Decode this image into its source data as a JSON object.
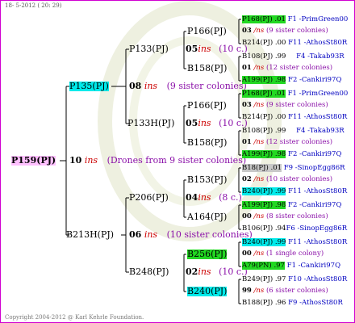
{
  "header": {
    "date": "18- 5-2012 ( 20: 29)"
  },
  "copyright": "Copyright 2004-2012 @ Karl Kehrle Foundation.",
  "root": {
    "name": "P159(PJ)",
    "gen": "10",
    "ins": "ins",
    "note": "(Drones from 9 sister colonies)"
  },
  "mother": {
    "name": "P135(PJ)",
    "gen": "08",
    "ins": "ins",
    "note": "(9 sister colonies)"
  },
  "p133": {
    "name": "P133(PJ)",
    "gen": "05",
    "ins": "ins",
    "note": "(10 c.)"
  },
  "p133h": {
    "name": "P133H(PJ)",
    "gen": "05",
    "ins": "ins",
    "note": "(10 c.)"
  },
  "b213": {
    "name": "B213H(PJ)",
    "gen": "06",
    "ins": "ins",
    "note": "(10 sister colonies)"
  },
  "p206": {
    "name": "P206(PJ)",
    "gen": "04",
    "ins": "ins",
    "note": "(8 c.)"
  },
  "b248": {
    "name": "B248(PJ)",
    "gen": "02",
    "ins": "ins",
    "note": "(10 c.)"
  },
  "p166a": "P166(PJ)",
  "b158a": "B158(PJ)",
  "p166b": "P166(PJ)",
  "b158b": "B158(PJ)",
  "b153": "B153(PJ)",
  "a164": "A164(PJ)",
  "b256": "B256(PJ)",
  "b240": "B240(PJ)",
  "r1": {
    "code": "P168(PJ) .01",
    "mark": "F1 -PrimGreen00"
  },
  "r2": {
    "gen": "03",
    "ins": "/ns",
    "note": "(9 sister colonies)"
  },
  "r3": {
    "code": "B214(PJ) .00",
    "mark": "F11 -AthosSt80R"
  },
  "r4": {
    "code": "B108(PJ) .99",
    "mark": "F4 -Takab93R"
  },
  "r5": {
    "gen": "01",
    "ins": "/ns",
    "note": "(12 sister colonies)"
  },
  "r6": {
    "code": "A199(PJ) .98",
    "mark": "F2 -Cankiri97Q"
  },
  "r7": {
    "code": "P168(PJ) .01",
    "mark": "F1 -PrimGreen00"
  },
  "r8": {
    "gen": "03",
    "ins": "/ns",
    "note": "(9 sister colonies)"
  },
  "r9": {
    "code": "B214(PJ) .00",
    "mark": "F11 -AthosSt80R"
  },
  "r10": {
    "code": "B108(PJ) .99",
    "mark": "F4 -Takab93R"
  },
  "r11": {
    "gen": "01",
    "ins": "/ns",
    "note": "(12 sister colonies)"
  },
  "r12": {
    "code": "A199(PJ) .98",
    "mark": "F2 -Cankiri97Q"
  },
  "r13": {
    "code": "B18(PJ) .01",
    "mark": "F9 -SinopEgg86R"
  },
  "r14": {
    "gen": "02",
    "ins": "/ns",
    "note": "(10 sister colonies)"
  },
  "r15": {
    "code": "B240(PJ) .99",
    "mark": "F11 -AthosSt80R"
  },
  "r16": {
    "code": "A199(PJ) .98",
    "mark": "F2 -Cankiri97Q"
  },
  "r17": {
    "gen": "00",
    "ins": "/ns",
    "note": "(8 sister colonies)"
  },
  "r18": {
    "code": "B106(PJ) .94",
    "mark": "F6 -SinopEgg86R"
  },
  "r19": {
    "code": "B240(PJ) .99",
    "mark": "F11 -AthosSt80R"
  },
  "r20": {
    "gen": "00",
    "ins": "/ns",
    "note": "(1 single colony)"
  },
  "r21": {
    "code": "A79(PN) .97",
    "mark": "F1 -Cankiri97Q"
  },
  "r22": {
    "code": "B249(PJ) .97",
    "mark": "F10 -AthosSt80R"
  },
  "r23": {
    "gen": "99",
    "ins": "/ns",
    "note": "(6 sister colonies)"
  },
  "r24": {
    "code": "B188(PJ) .96",
    "mark": "F9 -AthosSt80R"
  }
}
